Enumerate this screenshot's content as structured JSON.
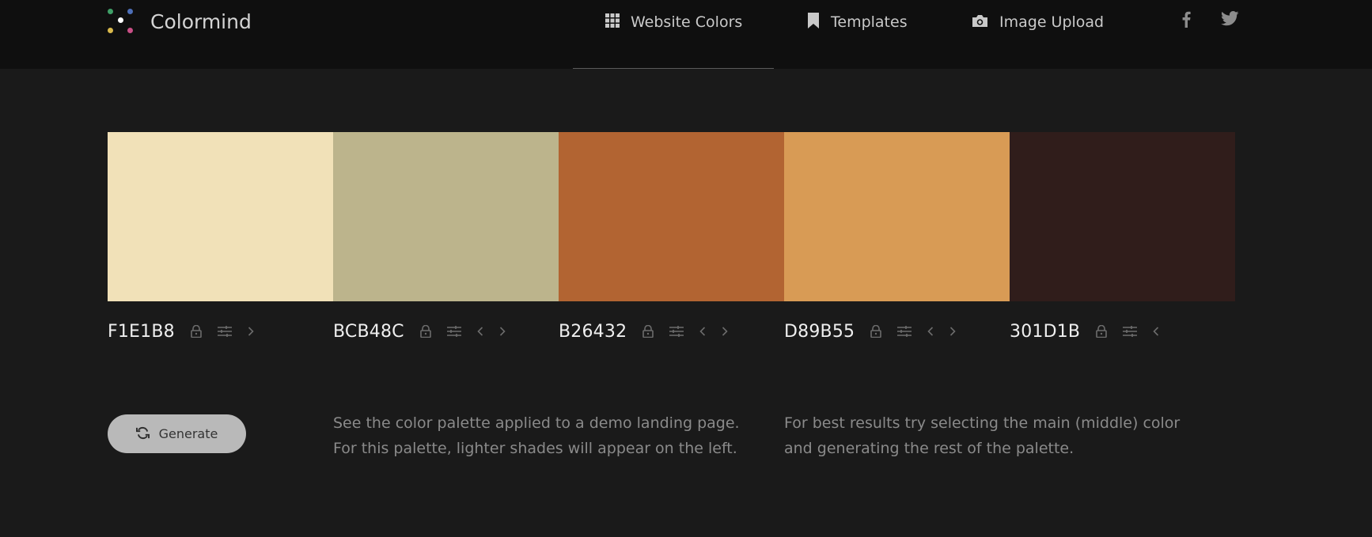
{
  "app": {
    "name": "Colormind"
  },
  "nav": {
    "website_colors": "Website Colors",
    "templates": "Templates",
    "image_upload": "Image Upload",
    "icons": {
      "website_colors": "grid-icon",
      "templates": "bookmark-icon",
      "image_upload": "camera-icon",
      "facebook": "facebook-icon",
      "twitter": "twitter-icon"
    }
  },
  "palette": [
    {
      "hex": "F1E1B8",
      "color": "#F1E1B8",
      "has_left_arrow": false,
      "has_right_arrow": true
    },
    {
      "hex": "BCB48C",
      "color": "#BCB48C",
      "has_left_arrow": true,
      "has_right_arrow": true
    },
    {
      "hex": "B26432",
      "color": "#B26432",
      "has_left_arrow": true,
      "has_right_arrow": true
    },
    {
      "hex": "D89B55",
      "color": "#D89B55",
      "has_left_arrow": true,
      "has_right_arrow": true
    },
    {
      "hex": "301D1B",
      "color": "#301D1B",
      "has_left_arrow": true,
      "has_right_arrow": false
    }
  ],
  "actions": {
    "generate": "Generate"
  },
  "notes": {
    "demo_line1": "See the color palette applied to a demo landing page.",
    "demo_line2": "For this palette, lighter shades will appear on the left.",
    "tip_line1": "For best results try selecting the main (middle) color",
    "tip_line2": "and generating the rest of the palette."
  },
  "colors": {
    "topbar_bg": "#0f0f0f",
    "page_bg": "#1a1a1a",
    "button_bg": "#b9b9b9"
  }
}
